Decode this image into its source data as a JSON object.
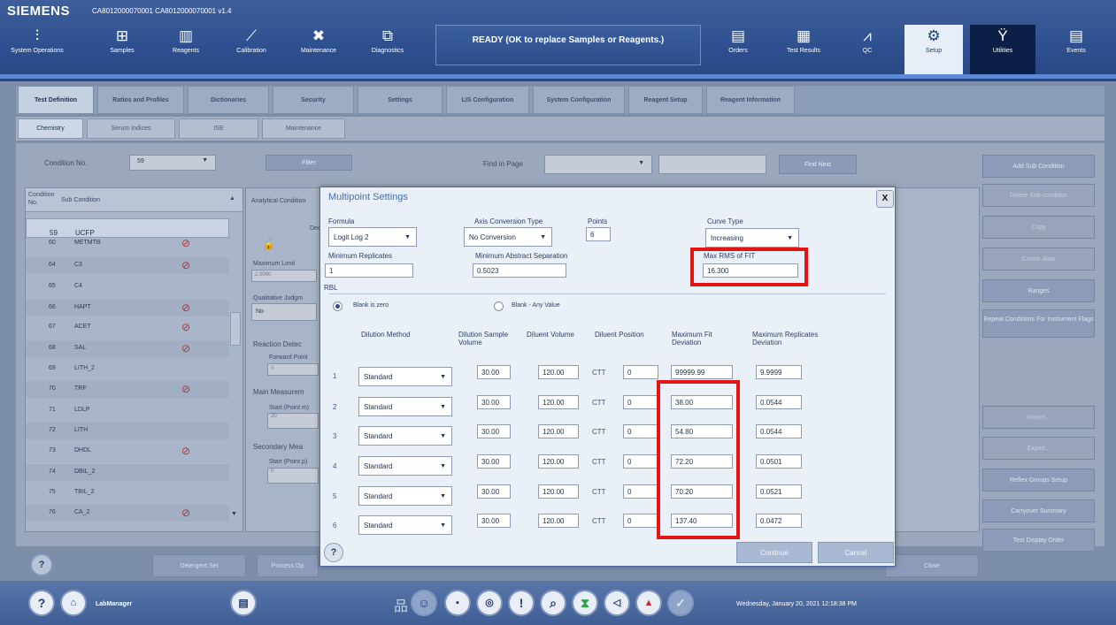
{
  "header": {
    "brand": "SIEMENS",
    "system_id": "CA8012000070001 CA8012000070001 v1.4",
    "status": "READY (OK to replace Samples or Reagents.)",
    "nav": [
      {
        "label": "System Operations",
        "icon": "⫶"
      },
      {
        "label": "Samples",
        "icon": "⊞"
      },
      {
        "label": "Reagents",
        "icon": "▥"
      },
      {
        "label": "Calibration",
        "icon": "⟋"
      },
      {
        "label": "Maintenance",
        "icon": "✖"
      },
      {
        "label": "Diagnostics",
        "icon": "⧉"
      },
      {
        "label": "Orders",
        "icon": "▤"
      },
      {
        "label": "Test Results",
        "icon": "▦"
      },
      {
        "label": "QC",
        "icon": "⩘"
      },
      {
        "label": "Setup",
        "icon": "⚙"
      },
      {
        "label": "Utilities",
        "icon": "Ϋ"
      },
      {
        "label": "Events",
        "icon": "▤"
      }
    ]
  },
  "tabs_main": [
    "Test Definition",
    "Ratios and Profiles",
    "Dictionaries",
    "Security",
    "Settings",
    "LIS Configuration",
    "System Configuration",
    "Reagent Setup",
    "Reagent Information"
  ],
  "tabs_sub": [
    "Chemistry",
    "Serum Indices",
    "ISE",
    "Maintenance"
  ],
  "filter": {
    "condition_label": "Condition No.",
    "condition_value": "59",
    "filter_button": "Filter",
    "find_label": "Find in Page",
    "find_next": "Find Next"
  },
  "condition_table": {
    "col_no": "Condition No.",
    "col_sub": "Sub Condition",
    "rows": [
      {
        "no": "59",
        "name": "UCFP"
      },
      {
        "no": "60",
        "name": "METMTB"
      },
      {
        "no": "64",
        "name": "C3"
      },
      {
        "no": "65",
        "name": "C4"
      },
      {
        "no": "66",
        "name": "HAPT"
      },
      {
        "no": "67",
        "name": "ACET"
      },
      {
        "no": "68",
        "name": "SAL"
      },
      {
        "no": "69",
        "name": "LITH_2"
      },
      {
        "no": "70",
        "name": "TRF"
      },
      {
        "no": "71",
        "name": "LDLP"
      },
      {
        "no": "72",
        "name": "LITH"
      },
      {
        "no": "73",
        "name": "DHDL"
      },
      {
        "no": "74",
        "name": "DBIL_2"
      },
      {
        "no": "75",
        "name": "TBIL_2"
      },
      {
        "no": "76",
        "name": "CA_2"
      }
    ]
  },
  "analytical": {
    "title": "Analytical Condition",
    "decimal": "Decim",
    "decimal_value": "1",
    "max_limit": "Maximum Limit",
    "max_limit_value": "2.0000",
    "qual_judge": "Qualitative Judgm",
    "qual_value": "No",
    "reaction": "Reaction Detec",
    "forward_point": "Forward Point",
    "forward_value": "0",
    "main_meas": "Main Measurem",
    "start_m": "Start (Point m)",
    "start_m_value": "20",
    "secondary": "Secondary Mea",
    "start_p": "Start (Point p)",
    "start_p_value": "0"
  },
  "right_buttons": [
    "Add Sub Condition",
    "Delete Sub-condition",
    "Copy",
    "Create Alias",
    "Ranges",
    "Repeat Conditions For Instrument Flags",
    "Import...",
    "Export...",
    "Reflex Groups Setup",
    "Carryover Summary",
    "Test Display Order"
  ],
  "bottom_buttons": [
    "Detergent Set",
    "Process Op",
    "Close"
  ],
  "footer": {
    "user": "LabManager",
    "datetime": "Wednesday, January 20, 2021 12:18:38 PM"
  },
  "dialog": {
    "title": "Multipoint Settings",
    "close": "X",
    "formula_label": "Formula",
    "formula_value": "Logit Log 2",
    "axis_label": "Axis Conversion Type",
    "axis_value": "No Conversion",
    "points_label": "Points",
    "points_value": "6",
    "curve_label": "Curve Type",
    "curve_value": "Increasing",
    "min_rep_label": "Minimum Replicates",
    "min_rep_value": "1",
    "min_abs_label": "Minimum Abstract Separation",
    "min_abs_value": "0.5023",
    "max_rms_label": "Max RMS of FIT",
    "max_rms_value": "16.300",
    "rbl_label": "RBL",
    "blank_zero": "Blank is zero",
    "blank_any": "Blank - Any Value",
    "columns": {
      "dilution_method": "Dilution Method",
      "dilution_sample_volume": "Dilution Sample Volume",
      "diluent_volume": "Diluent Volume",
      "diluent_position": "Diluent Position",
      "max_fit_dev": "Maximum Fit Deviation",
      "max_rep_dev": "Maximum Replicates Deviation"
    },
    "rows": [
      {
        "n": "1",
        "method": "Standard",
        "sample_vol": "30.00",
        "diluent_vol": "120.00",
        "pos_type": "CTT",
        "pos": "0",
        "fit_dev": "99999.99",
        "rep_dev": "9.9999"
      },
      {
        "n": "2",
        "method": "Standard",
        "sample_vol": "30.00",
        "diluent_vol": "120.00",
        "pos_type": "CTT",
        "pos": "0",
        "fit_dev": "38.00",
        "rep_dev": "0.0544"
      },
      {
        "n": "3",
        "method": "Standard",
        "sample_vol": "30.00",
        "diluent_vol": "120.00",
        "pos_type": "CTT",
        "pos": "0",
        "fit_dev": "54.80",
        "rep_dev": "0.0544"
      },
      {
        "n": "4",
        "method": "Standard",
        "sample_vol": "30.00",
        "diluent_vol": "120.00",
        "pos_type": "CTT",
        "pos": "0",
        "fit_dev": "72.20",
        "rep_dev": "0.0501"
      },
      {
        "n": "5",
        "method": "Standard",
        "sample_vol": "30.00",
        "diluent_vol": "120.00",
        "pos_type": "CTT",
        "pos": "0",
        "fit_dev": "70.20",
        "rep_dev": "0.0521"
      },
      {
        "n": "6",
        "method": "Standard",
        "sample_vol": "30.00",
        "diluent_vol": "120.00",
        "pos_type": "CTT",
        "pos": "0",
        "fit_dev": "137.40",
        "rep_dev": "0.0472"
      }
    ],
    "continue": "Continue",
    "cancel": "Cancel",
    "help": "?"
  },
  "colors": {
    "header": "#2e4f8f",
    "highlight": "#e41414",
    "dialog_bg": "#eaf0f8"
  }
}
